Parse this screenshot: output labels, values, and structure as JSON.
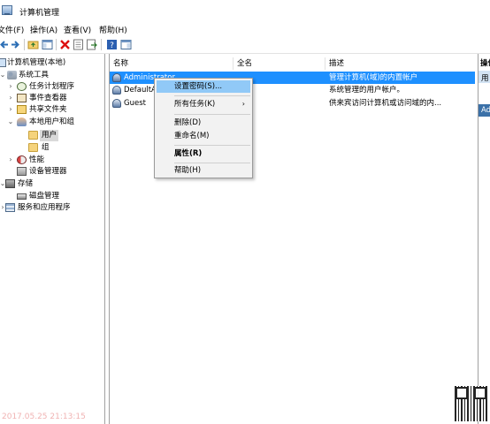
{
  "window": {
    "title": "计算机管理"
  },
  "menubar": {
    "items": [
      "文件(F)",
      "操作(A)",
      "查看(V)",
      "帮助(H)"
    ]
  },
  "toolbar": {
    "icons": [
      "back-icon",
      "forward-icon",
      "up-folder-icon",
      "show-hide-tree-icon",
      "delete-icon",
      "properties-icon",
      "export-icon",
      "help-icon",
      "show-action-pane-icon"
    ]
  },
  "tree": {
    "root": "计算机管理(本地)",
    "system_tools": "系统工具",
    "task_scheduler": "任务计划程序",
    "event_viewer": "事件查看器",
    "shared_folders": "共享文件夹",
    "local_users_groups": "本地用户和组",
    "users": "用户",
    "groups": "组",
    "performance": "性能",
    "device_manager": "设备管理器",
    "storage": "存储",
    "disk_management": "磁盘管理",
    "services_apps": "服务和应用程序"
  },
  "list": {
    "columns": [
      "名称",
      "全名",
      "描述"
    ],
    "rows": [
      {
        "name": "Administrator",
        "fullname": "",
        "description": "管理计算机(域)的内置帐户"
      },
      {
        "name": "DefaultA",
        "fullname": "",
        "description": "系统管理的用户帐户。"
      },
      {
        "name": "Guest",
        "fullname": "",
        "description": "供来宾访问计算机或访问域的内..."
      }
    ]
  },
  "context_menu": {
    "set_password": "设置密码(S)...",
    "all_tasks": "所有任务(K)",
    "all_tasks_arrow": "›",
    "delete": "删除(D)",
    "rename": "重命名(M)",
    "properties": "属性(R)",
    "help": "帮助(H)"
  },
  "action_pane": {
    "header": "操作",
    "item1": "用",
    "item2": "Ad"
  },
  "watermark": {
    "timestamp": "2017.05.25 21:13:15"
  }
}
